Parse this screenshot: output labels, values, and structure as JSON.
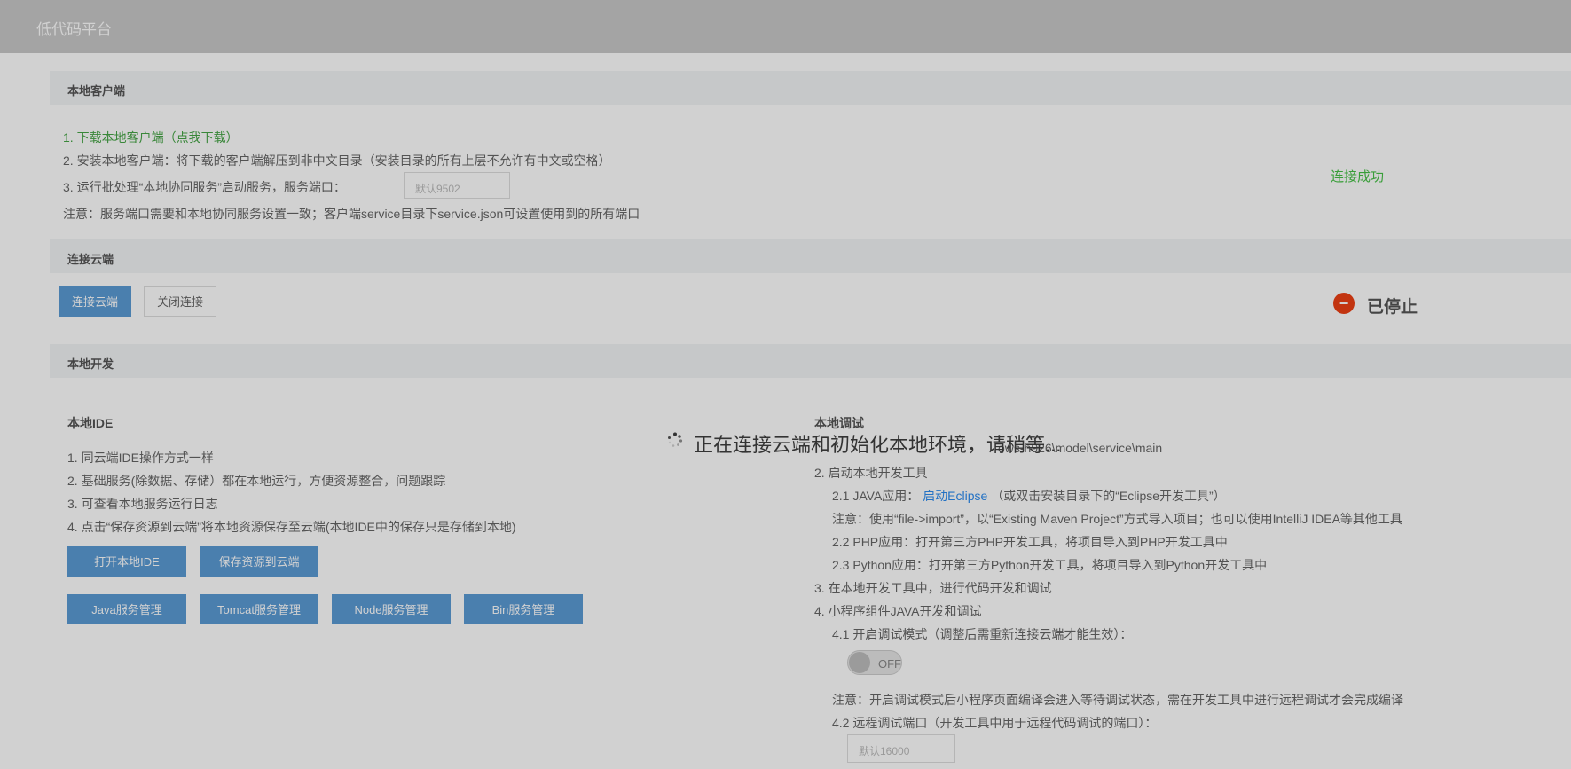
{
  "header": {
    "title": "低代码平台"
  },
  "local_client": {
    "section_title": "本地客户端",
    "step1": "1. 下载本地客户端（点我下载）",
    "step2": "2. 安装本地客户端：将下载的客户端解压到非中文目录（安装目录的所有上层不允许有中文或空格）",
    "step3": "3. 运行批处理“本地协同服务”启动服务，服务端口：",
    "port_placeholder": "默认9502",
    "note": "注意：服务端口需要和本地协同服务设置一致；客户端service目录下service.json可设置使用到的所有端口",
    "status": "连接成功"
  },
  "cloud": {
    "section_title": "连接云端",
    "connect_button": "连接云端",
    "close_button": "关闭连接",
    "status": "已停止",
    "status_icon": "stop-icon"
  },
  "local_dev": {
    "section_title": "本地开发",
    "ide": {
      "title": "本地IDE",
      "items": [
        "1. 同云端IDE操作方式一样",
        "2. 基础服务(除数据、存储）都在本地运行，方便资源整合，问题跟踪",
        "3. 可查看本地服务运行日志",
        "4. 点击“保存资源到云端”将本地资源保存至云端(本地IDE中的保存只是存储到本地)"
      ],
      "buttons_row1": [
        "打开本地IDE",
        "保存资源到云端"
      ],
      "buttons_row2": [
        "Java服务管理",
        "Tomcat服务管理",
        "Node服务管理",
        "Bin服务管理"
      ]
    },
    "debug": {
      "title": "本地调试",
      "path_fragment": "ows-h926\\model\\service\\main",
      "step2": "2. 启动本地开发工具",
      "java_prefix": "2.1 JAVA应用：",
      "java_link": "启动Eclipse",
      "java_suffix": "（或双击安装目录下的“Eclipse开发工具”）",
      "java_note": "注意：使用“file->import”，以“Existing Maven Project”方式导入项目；也可以使用IntelliJ IDEA等其他工具",
      "php": "2.2 PHP应用：打开第三方PHP开发工具，将项目导入到PHP开发工具中",
      "python": "2.3 Python应用：打开第三方Python开发工具，将项目导入到Python开发工具中",
      "step3": "3. 在本地开发工具中，进行代码开发和调试",
      "step4": "4. 小程序组件JAVA开发和调试",
      "step41": "4.1 开启调试模式（调整后需重新连接云端才能生效）：",
      "toggle_label": "OFF",
      "toggle_on": false,
      "note2": "注意：开启调试模式后小程序页面编译会进入等待调试状态，需在开发工具中进行远程调试才会完成编译",
      "step42": "4.2 远程调试端口（开发工具中用于远程代码调试的端口）：",
      "debug_port_placeholder": "默认16000"
    }
  },
  "loading": {
    "message": "正在连接云端和初始化本地环境，请稍等..."
  }
}
